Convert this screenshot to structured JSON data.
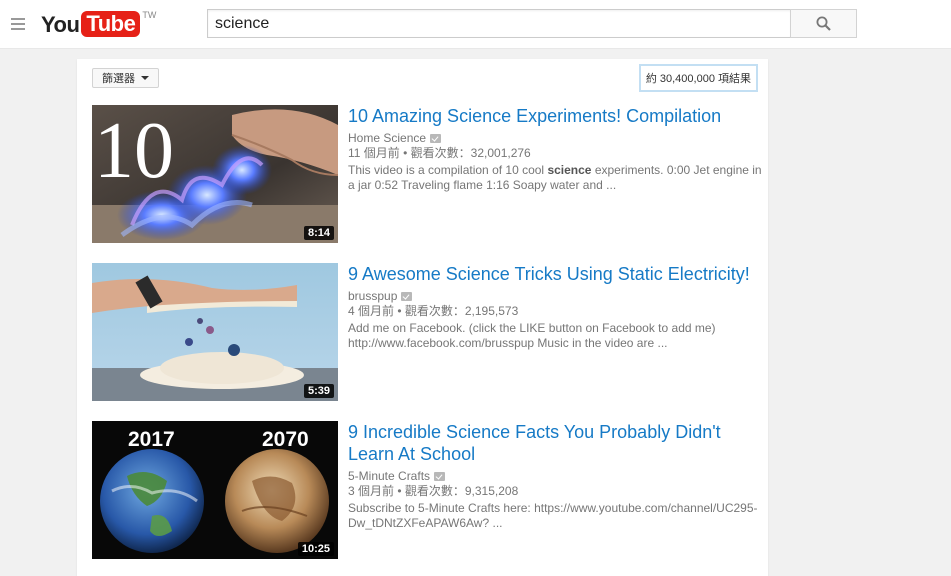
{
  "header": {
    "logo_you": "You",
    "logo_tube": "Tube",
    "logo_country": "TW",
    "search_value": "science"
  },
  "toolbar": {
    "filter_label": "篩選器",
    "result_count": "約 30,400,000 項結果"
  },
  "results": [
    {
      "title": "10 Amazing Science Experiments! Compilation",
      "channel": "Home Science",
      "meta": "11 個月前 • 觀看次數：32,001,276",
      "desc_before": "This video is a compilation of 10 cool ",
      "desc_bold": "science",
      "desc_after": " experiments. 0:00 Jet engine in a jar 0:52 Traveling flame 1:16 Soapy water and ...",
      "duration": "8:14",
      "thumb_text": "10"
    },
    {
      "title": "9 Awesome Science Tricks Using Static Electricity!",
      "channel": "brusspup",
      "meta": "4 個月前 • 觀看次數：2,195,573",
      "desc_before": "Add me on Facebook. (click the LIKE button on Facebook to add me) http://www.facebook.com/brusspup Music in the video are ...",
      "desc_bold": "",
      "desc_after": "",
      "duration": "5:39"
    },
    {
      "title": "9 Incredible Science Facts You Probably Didn't Learn At School",
      "channel": "5-Minute Crafts",
      "meta": "3 個月前 • 觀看次數：9,315,208",
      "desc_before": "Subscribe to 5-Minute Crafts here: https://www.youtube.com/channel/UC295-Dw_tDNtZXFeAPAW6Aw? ...",
      "desc_bold": "",
      "desc_after": "",
      "duration": "10:25",
      "thumb_left_text": "2017",
      "thumb_right_text": "2070"
    }
  ]
}
